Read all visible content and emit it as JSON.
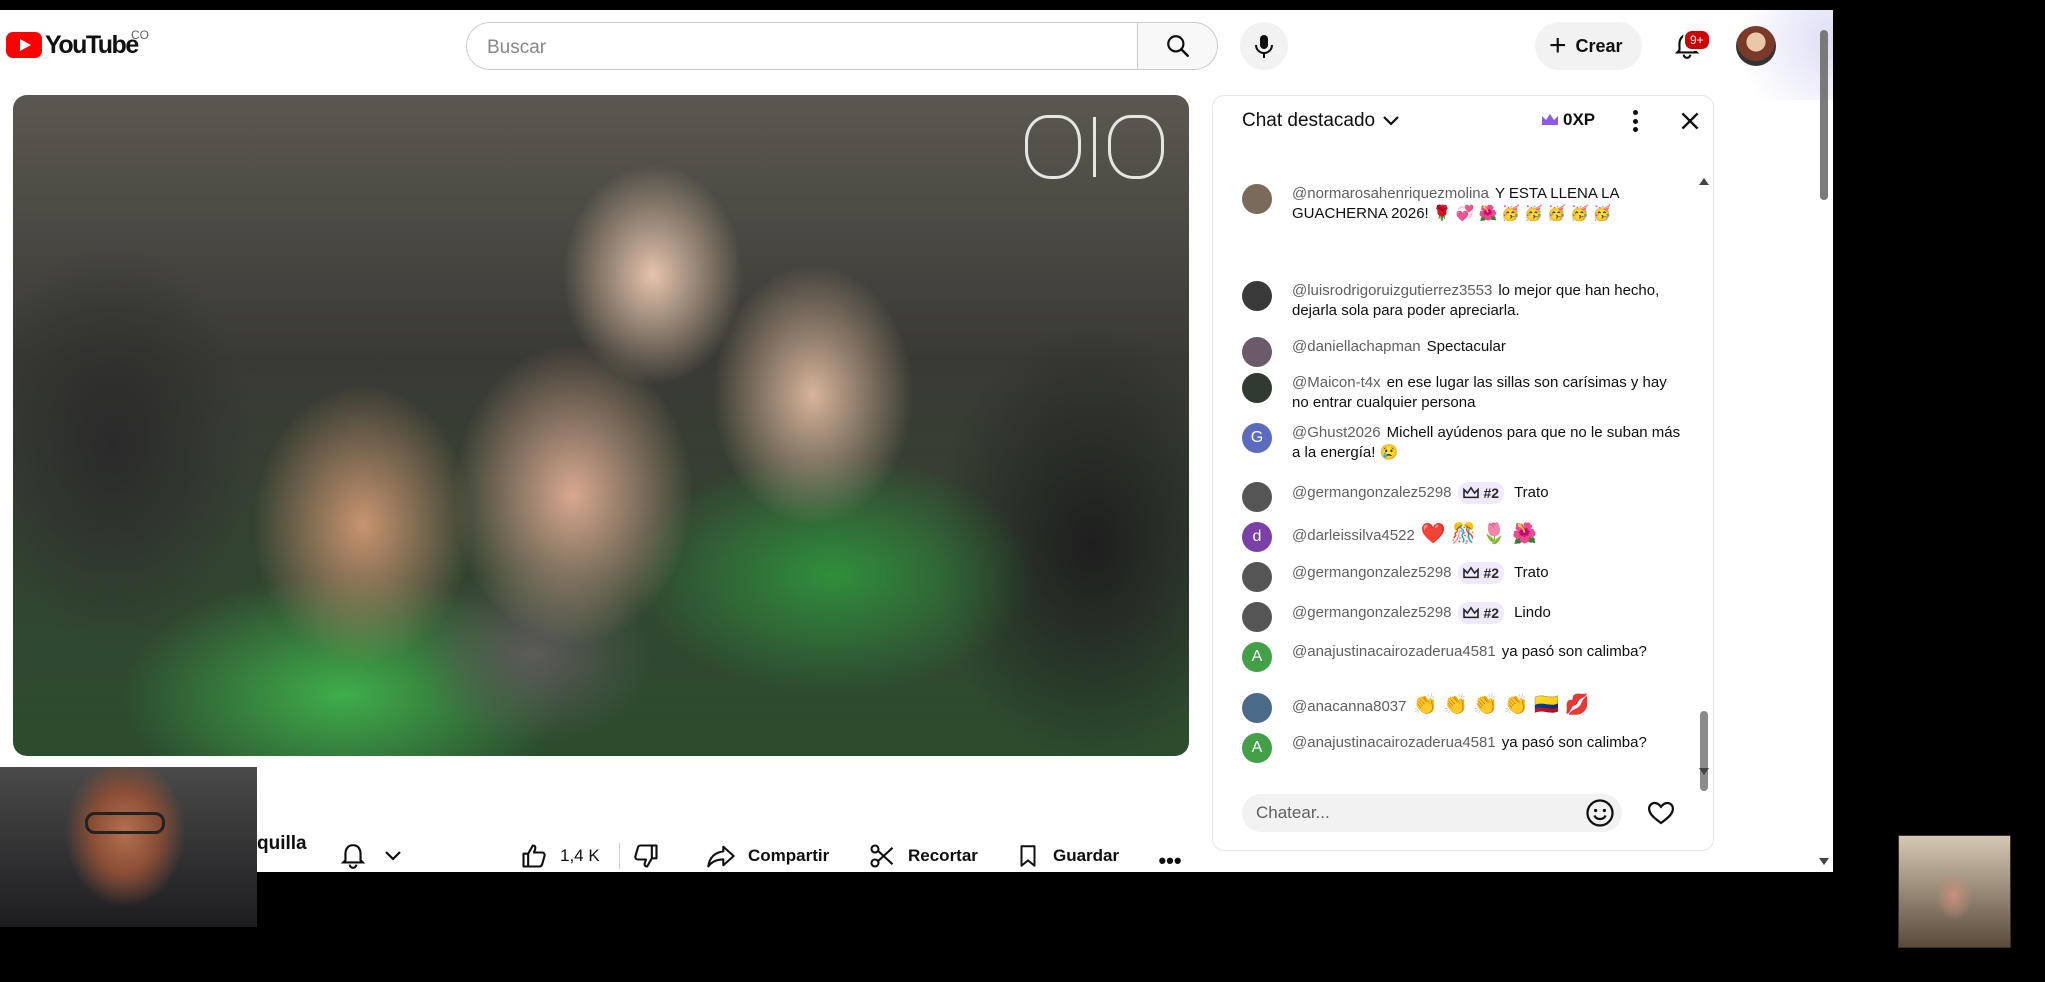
{
  "header": {
    "logo_text": "YouTube",
    "country_code": "CO",
    "search_placeholder": "Buscar",
    "create_label": "Crear",
    "notification_count": "9+"
  },
  "video": {
    "channel_name_partial": "quilla"
  },
  "actions": {
    "like_count": "1,4 K",
    "share_label": "Compartir",
    "clip_label": "Recortar",
    "save_label": "Guardar",
    "more_label": "•••"
  },
  "chat": {
    "title": "Chat destacado",
    "xp": "0XP",
    "input_placeholder": "Chatear...",
    "messages": [
      {
        "author": "@normarosahenriquezmolina",
        "text": "Y ESTA LLENA LA GUACHERNA 2026! 🌹 💞 🌺 🥳 🥳 🥳 🥳 🥳",
        "avatar": "",
        "avatar_color": "#7a6a5a"
      },
      {
        "author": "@luisrodrigoruizgutierrez3553",
        "text": "lo mejor que han hecho, dejarla sola para poder apreciarla.",
        "avatar": "",
        "avatar_color": "#3a3a3a"
      },
      {
        "author": "@daniellachapman",
        "text": "Spectacular",
        "avatar": "",
        "avatar_color": "#6a5a6a"
      },
      {
        "author": "@Maicon-t4x",
        "text": "en ese lugar las sillas son carísimas y hay no entrar cualquier persona",
        "avatar": "",
        "avatar_color": "#2f3a30"
      },
      {
        "author": "@Ghust2026",
        "text": "Michell ayúdenos para que no le suban más a la energía! 😢",
        "avatar": "G",
        "avatar_color": "#5c6bc0"
      },
      {
        "author": "@germangonzalez5298",
        "rank": "#2",
        "text": "Trato",
        "avatar": "",
        "avatar_color": "#555"
      },
      {
        "author": "@darleissilva4522",
        "text": "❤️ 🎊 🌷 🌺",
        "avatar": "d",
        "avatar_color": "#7b3fa8"
      },
      {
        "author": "@germangonzalez5298",
        "rank": "#2",
        "text": "Trato",
        "avatar": "",
        "avatar_color": "#555"
      },
      {
        "author": "@germangonzalez5298",
        "rank": "#2",
        "text": "Lindo",
        "avatar": "",
        "avatar_color": "#555"
      },
      {
        "author": "@anajustinacairozaderua4581",
        "text": "ya pasó son calimba?",
        "avatar": "A",
        "avatar_color": "#43a047"
      },
      {
        "author": "@anacanna8037",
        "text": "👏 👏 👏 👏 🇨🇴 💋",
        "avatar": "",
        "avatar_color": "#4a6a8a"
      },
      {
        "author": "@anajustinacairozaderua4581",
        "text": "ya pasó son calimba?",
        "avatar": "A",
        "avatar_color": "#43a047"
      }
    ]
  },
  "colors": {
    "brand_red": "#ff0000",
    "chat_author": "#606060"
  }
}
